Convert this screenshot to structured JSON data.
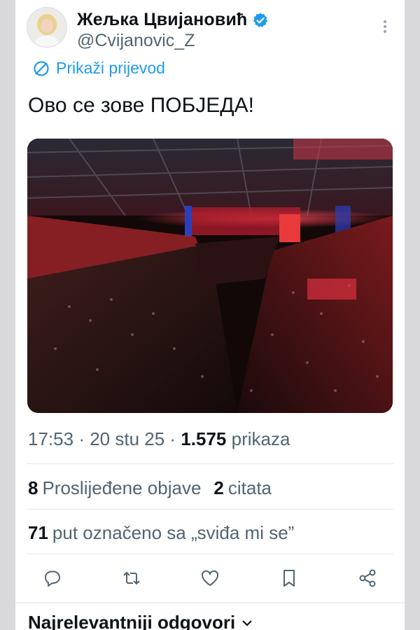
{
  "tweet": {
    "display_name": "Жељка Цвијановић",
    "handle": "@Cvijanovic_Z",
    "translate_label": "Prikaži prijevod",
    "text": "Ово се зове ПОБЈЕДА!",
    "time": "17:53",
    "date": "20 stu 25",
    "views_count": "1.575",
    "views_label": "prikaza",
    "reposts_count": "8",
    "reposts_label": "Proslijeđene objave",
    "quotes_count": "2",
    "quotes_label": "citata",
    "likes_count": "71",
    "likes_label": "put označeno sa „sviđa mi se”"
  },
  "replies": {
    "sort_label": "Najrelevantniji odgovori"
  },
  "icons": {
    "verified": "verified-badge-icon",
    "translate": "translate-icon",
    "more": "more-vertical-icon",
    "reply": "reply-icon",
    "repost": "repost-icon",
    "like": "heart-icon",
    "bookmark": "bookmark-icon",
    "share": "share-icon",
    "chevron": "chevron-down-icon"
  },
  "colors": {
    "accent": "#1d9bf0",
    "text": "#0f1419",
    "muted": "#536471"
  }
}
